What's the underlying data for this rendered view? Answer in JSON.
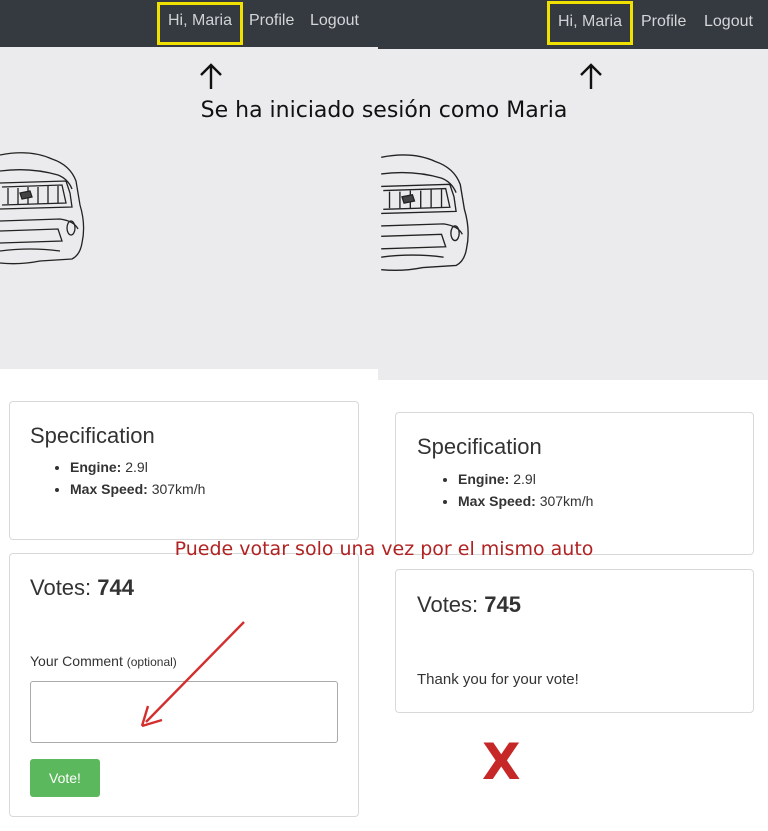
{
  "nav": {
    "greeting": "Hi, Maria",
    "profile": "Profile",
    "logout": "Logout"
  },
  "annotations": {
    "login_caption": "Se ha iniciado sesión como Maria",
    "vote_note": "Puede votar solo una vez por el mismo auto",
    "x_mark": "X",
    "accent_colors": {
      "highlight_box": "#f0e100",
      "note_red": "#b22222"
    }
  },
  "left": {
    "spec_title": "Specification",
    "engine_label": "Engine:",
    "engine_value": "2.9l",
    "speed_label": "Max Speed:",
    "speed_value": "307km/h",
    "votes_label": "Votes:",
    "votes_value": "744",
    "comment_label": "Your Comment",
    "comment_optional": "(optional)",
    "vote_button": "Vote!"
  },
  "right": {
    "spec_title": "Specification",
    "engine_label": "Engine:",
    "engine_value": "2.9l",
    "speed_label": "Max Speed:",
    "speed_value": "307km/h",
    "votes_label": "Votes:",
    "votes_value": "745",
    "thanks_message": "Thank you for your vote!"
  },
  "theme": {
    "navbar_bg": "#343a40",
    "hero_bg": "#ebebed",
    "button_green": "#5cb85c"
  }
}
